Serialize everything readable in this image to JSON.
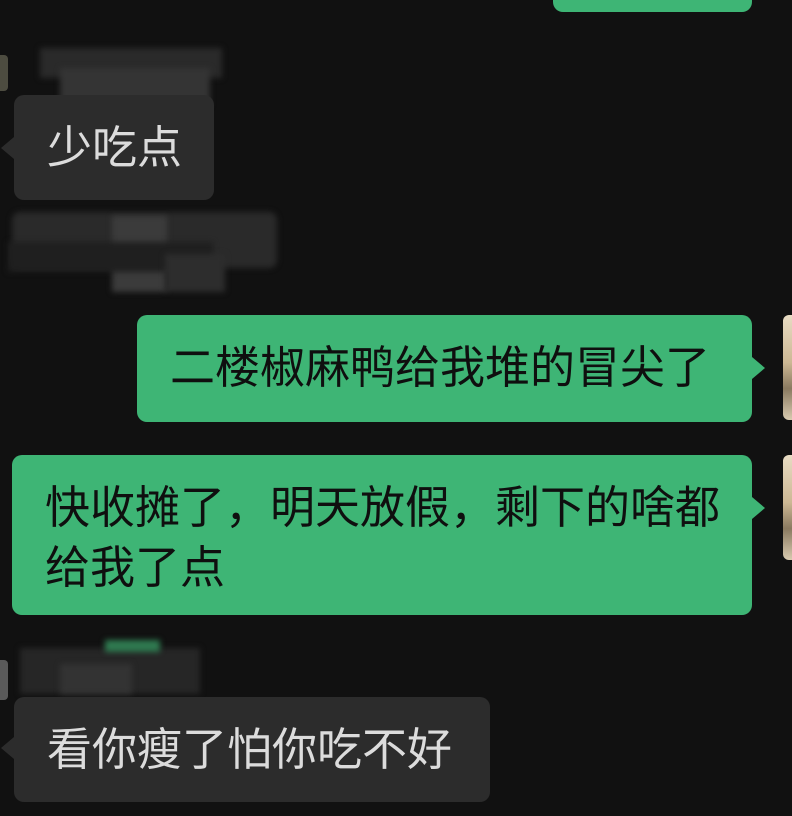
{
  "colors": {
    "background": "#111111",
    "self_bubble": "#3eb575",
    "other_bubble": "#2c2c2c",
    "self_text": "#0f0f0f",
    "other_text": "#dcdcdc"
  },
  "messages": [
    {
      "sender": "self",
      "lines": []
    },
    {
      "sender": "other",
      "lines": [
        "少吃点"
      ]
    },
    {
      "sender": "other",
      "lines": []
    },
    {
      "sender": "self",
      "lines": [
        "二楼椒麻鸭给我堆的冒尖了"
      ]
    },
    {
      "sender": "self",
      "lines": [
        "快收摊了，明天放假，剩下的啥都",
        "给我了点"
      ]
    },
    {
      "sender": "other",
      "lines": [
        "看你瘦了怕你吃不好"
      ]
    }
  ]
}
